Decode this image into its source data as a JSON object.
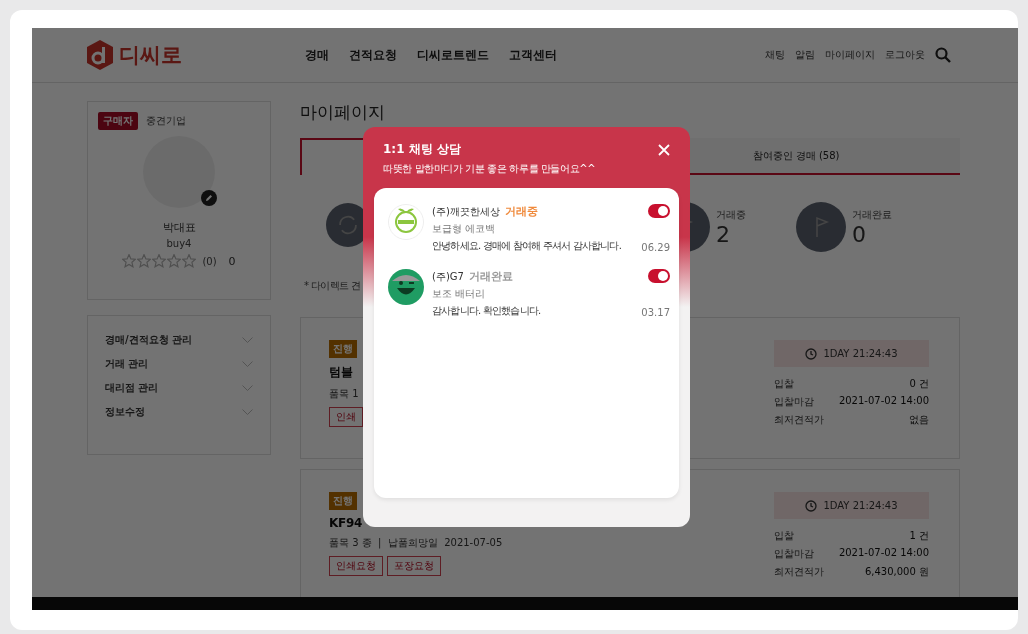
{
  "header": {
    "logo": "디씨로",
    "nav": [
      "경매",
      "견적요청",
      "디씨로트렌드",
      "고객센터"
    ],
    "links": [
      "채팅",
      "알림",
      "마이페이지",
      "로그아웃"
    ]
  },
  "profile": {
    "role_badge": "구매자",
    "company_type": "중견기업",
    "name": "박대표",
    "user_id": "buy4",
    "stars": 0,
    "review_count": "(0)",
    "score": "0"
  },
  "side_menu": [
    {
      "label": "경매/견적요청 관리"
    },
    {
      "label": "거래 관리"
    },
    {
      "label": "대리점 관리"
    },
    {
      "label": "정보수정"
    }
  ],
  "page_title": "마이페이지",
  "tabs": [
    {
      "selected": true
    },
    {
      "label": "참여중인 경매 (58)",
      "selected": false
    }
  ],
  "stats": [
    {
      "label": "거래중",
      "value": "2",
      "kind": "flag"
    },
    {
      "label": "거래완료",
      "value": "0",
      "kind": "flag"
    }
  ],
  "stats_note": "* 다이렉트 견",
  "auctions": [
    {
      "badge": "진행",
      "title": "텀블",
      "meta": "품목 1",
      "tags": [
        "인쇄"
      ],
      "timer": "1DAY 21:24:43",
      "rows": [
        {
          "label": "입찰",
          "value": "0 건"
        },
        {
          "label": "입찰마감",
          "value": "2021-07-02 14:00"
        },
        {
          "label": "최저견적가",
          "value": "없음"
        }
      ]
    },
    {
      "badge": "진행",
      "title": "KF94",
      "meta": "품목 3 종  |  납품희망일  2021-07-05",
      "tags": [
        "인쇄요청",
        "포장요청"
      ],
      "timer": "1DAY 21:24:43",
      "rows": [
        {
          "label": "입찰",
          "value": "1 건"
        },
        {
          "label": "입찰마감",
          "value": "2021-07-02 14:00"
        },
        {
          "label": "최저견적가",
          "value": "6,430,000 원"
        }
      ]
    }
  ],
  "chat_modal": {
    "title": "1:1 채팅 상담",
    "subtitle": "따뜻한 말한마디가 기분 좋은 하루를 만들어요^^",
    "chats": [
      {
        "name": "(주)깨끗한세상",
        "status": "거래중",
        "color": "#f08a3c",
        "product": "보급형 에코백",
        "message": "안녕하세요. 경매에 참여해 주셔서 감사합니다.",
        "time": "06.29",
        "on": true
      },
      {
        "name": "(주)G7",
        "status": "거래완료",
        "color": "#9a9a9a",
        "product": "보조 배터리",
        "message": "감사합니다. 확인했습니다.",
        "time": "03.17",
        "on": true
      }
    ]
  }
}
